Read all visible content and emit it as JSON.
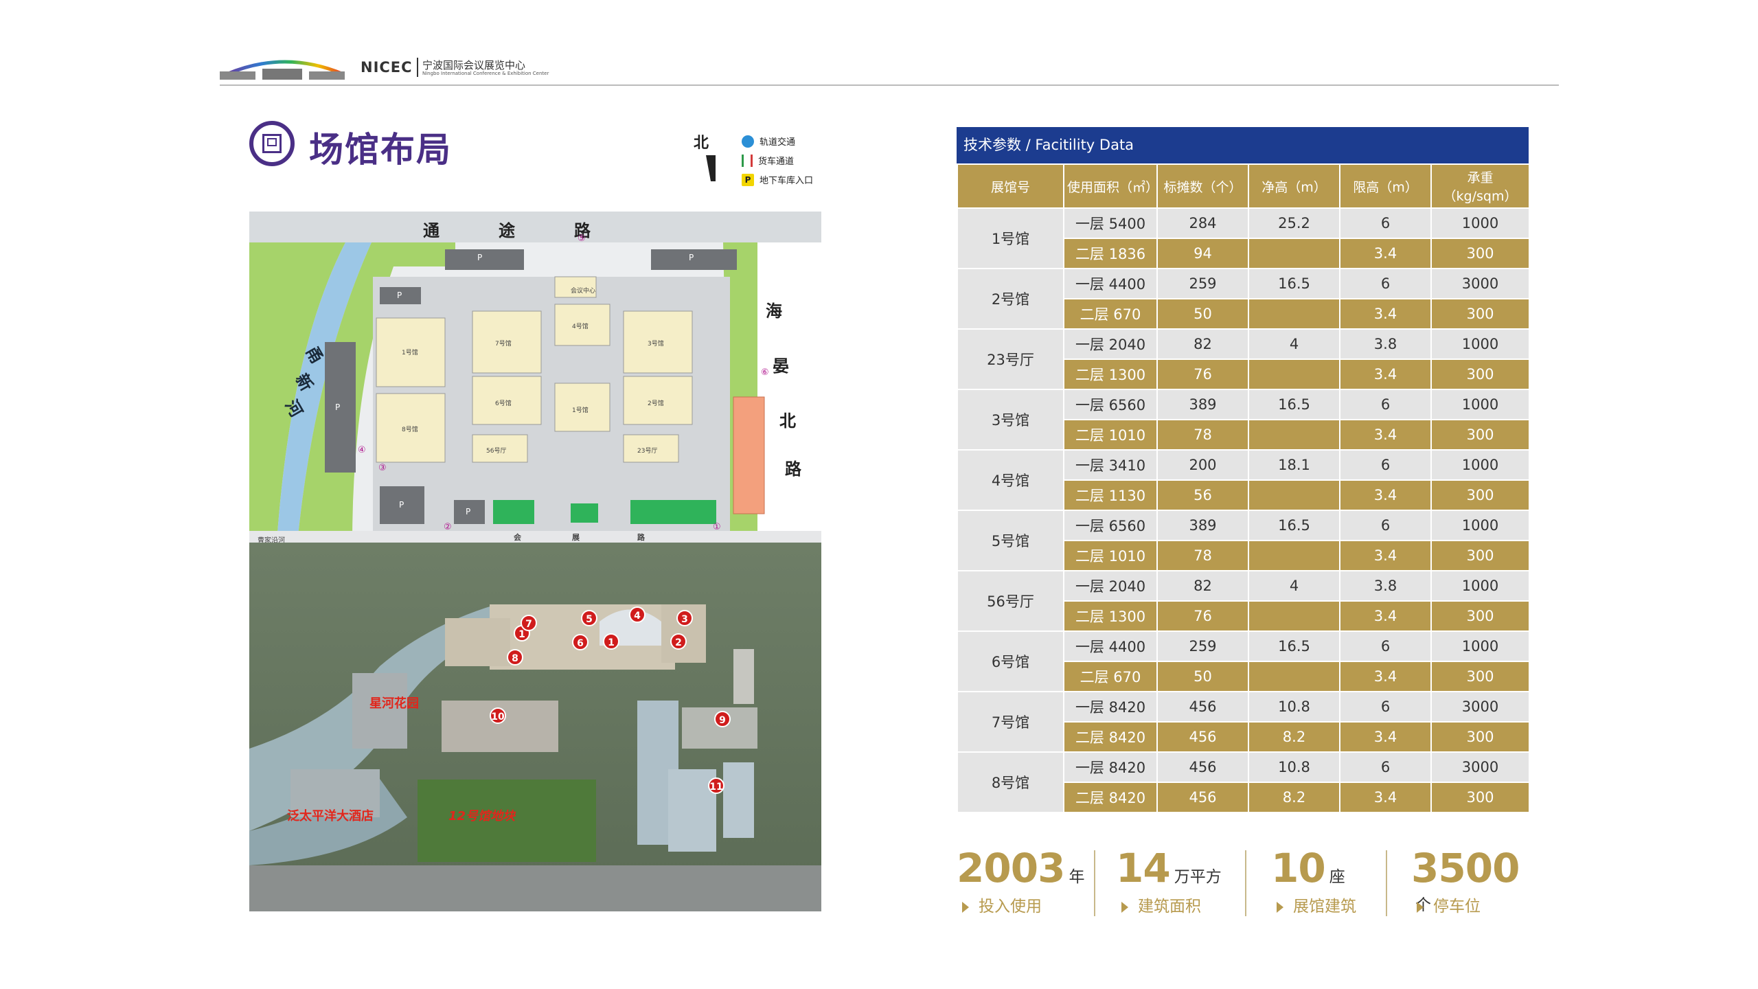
{
  "header": {
    "brand": "NICEC",
    "brand_cn": "宁波国际会议展览中心",
    "brand_en": "Ningbo International Conference & Exhibition Center"
  },
  "title": "场馆布局",
  "legend": {
    "north": "北",
    "items": [
      {
        "label": "轨道交通",
        "icon": "metro-icon",
        "color": "#2b8fd6"
      },
      {
        "label": "货车通道",
        "icon": "truck-lane-icon",
        "color": "#d33b3b"
      },
      {
        "label": "地下车库入口",
        "icon": "parking-entrance-icon",
        "color": "#f2d500"
      }
    ]
  },
  "map": {
    "roads": {
      "north": [
        "通",
        "途",
        "路"
      ],
      "east": [
        "海",
        "晏",
        "北",
        "路"
      ],
      "south": [
        "会",
        "展",
        "路"
      ],
      "river": [
        "甬",
        "新",
        "河"
      ]
    },
    "halls": [
      "1号馆",
      "2号馆",
      "3号馆",
      "4号馆",
      "5号馆",
      "6号馆",
      "7号馆",
      "8号馆",
      "23号厅",
      "56号厅"
    ],
    "gate_markers": [
      "①",
      "②",
      "③",
      "④",
      "⑤",
      "⑥"
    ],
    "parking": "P",
    "note": "会议中心",
    "corner_label": "曹家沿河"
  },
  "aerial": {
    "markers": [
      "1",
      "2",
      "3",
      "4",
      "5",
      "6",
      "7",
      "8",
      "9",
      "10",
      "11"
    ],
    "labels": [
      "星河花园",
      "泛太平洋大酒店",
      "12号馆地块"
    ]
  },
  "table": {
    "caption": "技术参数 / Facitility Data",
    "headers": [
      "展馆号",
      "使用面积（㎡）",
      "标摊数（个）",
      "净高（m）",
      "限高（m）",
      "承重（kg/sqm）"
    ],
    "rows": [
      {
        "hall": "1号馆",
        "f1": [
          "一层 5400",
          "284",
          "25.2",
          "6",
          "1000"
        ],
        "f2": [
          "二层 1836",
          "94",
          "",
          "3.4",
          "300"
        ]
      },
      {
        "hall": "2号馆",
        "f1": [
          "一层 4400",
          "259",
          "16.5",
          "6",
          "3000"
        ],
        "f2": [
          "二层 670",
          "50",
          "",
          "3.4",
          "300"
        ]
      },
      {
        "hall": "23号厅",
        "f1": [
          "一层 2040",
          "82",
          "4",
          "3.8",
          "1000"
        ],
        "f2": [
          "二层 1300",
          "76",
          "",
          "3.4",
          "300"
        ]
      },
      {
        "hall": "3号馆",
        "f1": [
          "一层 6560",
          "389",
          "16.5",
          "6",
          "1000"
        ],
        "f2": [
          "二层 1010",
          "78",
          "",
          "3.4",
          "300"
        ]
      },
      {
        "hall": "4号馆",
        "f1": [
          "一层 3410",
          "200",
          "18.1",
          "6",
          "1000"
        ],
        "f2": [
          "二层 1130",
          "56",
          "",
          "3.4",
          "300"
        ]
      },
      {
        "hall": "5号馆",
        "f1": [
          "一层 6560",
          "389",
          "16.5",
          "6",
          "1000"
        ],
        "f2": [
          "二层 1010",
          "78",
          "",
          "3.4",
          "300"
        ]
      },
      {
        "hall": "56号厅",
        "f1": [
          "一层 2040",
          "82",
          "4",
          "3.8",
          "1000"
        ],
        "f2": [
          "二层 1300",
          "76",
          "",
          "3.4",
          "300"
        ]
      },
      {
        "hall": "6号馆",
        "f1": [
          "一层 4400",
          "259",
          "16.5",
          "6",
          "1000"
        ],
        "f2": [
          "二层 670",
          "50",
          "",
          "3.4",
          "300"
        ]
      },
      {
        "hall": "7号馆",
        "f1": [
          "一层 8420",
          "456",
          "10.8",
          "6",
          "3000"
        ],
        "f2": [
          "二层 8420",
          "456",
          "8.2",
          "3.4",
          "300"
        ]
      },
      {
        "hall": "8号馆",
        "f1": [
          "一层 8420",
          "456",
          "10.8",
          "6",
          "3000"
        ],
        "f2": [
          "二层 8420",
          "456",
          "8.2",
          "3.4",
          "300"
        ]
      }
    ]
  },
  "stats": [
    {
      "num": "2003",
      "unit": "年",
      "desc": "投入使用"
    },
    {
      "num": "14",
      "unit": "万平方",
      "desc": "建筑面积"
    },
    {
      "num": "10",
      "unit": "座",
      "desc": "展馆建筑"
    },
    {
      "num": "3500",
      "unit": "个",
      "desc": "停车位"
    }
  ],
  "colors": {
    "purple": "#4a2f86",
    "gold": "#b79a4e",
    "navy": "#1c3c8f",
    "grey": "#e4e4e4"
  }
}
